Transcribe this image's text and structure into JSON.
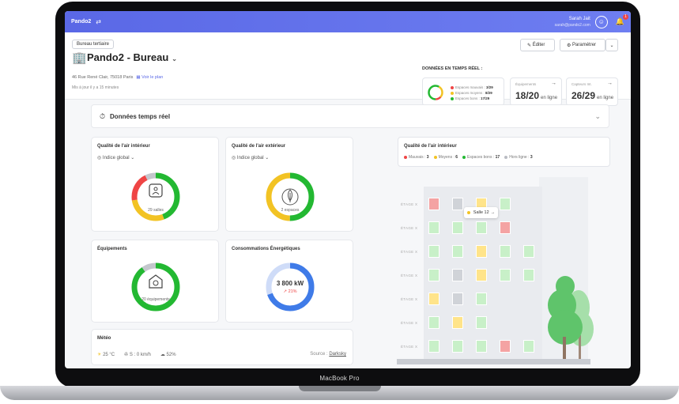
{
  "app": {
    "name": "Pando2",
    "user_name": "Sarah Jait",
    "user_email": "sarah@pando2.com",
    "notifications": "1"
  },
  "header": {
    "tag": "Bureau tertiaire",
    "title": "Pando2 - Bureau",
    "address": "46 Rue René Clair, 75018 Paris",
    "plan_link": "Voir le plan",
    "updated": "Mis à jour il y a 15 minutes",
    "edit_label": "Éditer",
    "settings_label": "Paramétrer",
    "realtime_label": "DONNÉES EN TEMPS RÉEL :"
  },
  "summary": {
    "spaces": [
      {
        "label": "Espaces mauvais :",
        "value": "3/29",
        "color": "#ef4545"
      },
      {
        "label": "Espaces moyens :",
        "value": "8/29",
        "color": "#f2c324"
      },
      {
        "label": "Espaces bons :",
        "value": "17/29",
        "color": "#23b832"
      }
    ],
    "equipment": {
      "label": "Équipements",
      "value": "18/20",
      "suffix": "en ligne"
    },
    "sensors": {
      "label": "Capteurs Int.",
      "value": "26/29",
      "suffix": "en ligne"
    }
  },
  "realtime": {
    "title": "Données temps réel"
  },
  "cards": {
    "air_in": {
      "title": "Qualité de l'air intérieur",
      "subtitle": "Indice global",
      "center": "29 salles"
    },
    "air_out": {
      "title": "Qualité de l'air extérieur",
      "subtitle": "Indice global",
      "center": "2 espaces"
    },
    "equip": {
      "title": "Équipements",
      "center": "20 équipements"
    },
    "energy": {
      "title": "Consommations Énergétiques",
      "value": "3 800 kW",
      "delta": "21%"
    },
    "meteo": {
      "title": "Météo",
      "temp": "25 °C",
      "wind": "S : 0 km/h",
      "humidity": "52%",
      "source_label": "Source :",
      "source": "Darksky"
    }
  },
  "building": {
    "title": "Qualité de l'air intérieur",
    "legend": [
      {
        "label": "Mauvais :",
        "value": "3",
        "color": "#ef4545"
      },
      {
        "label": "Moyens :",
        "value": "6",
        "color": "#f2c324"
      },
      {
        "label": "Espaces bons :",
        "value": "17",
        "color": "#23b832"
      },
      {
        "label": "Hors ligne :",
        "value": "3",
        "color": "#b9bcc3"
      }
    ],
    "floor_label": "ÉTAGE X",
    "tooltip": "Salle 12",
    "rows": [
      [
        "#f4a3a3",
        "#d0d3d8",
        "#ffe48a",
        "#c8f0c8"
      ],
      [
        "#c8f0c8",
        "#c8f0c8",
        "#c8f0c8",
        "#f4a3a3"
      ],
      [
        "#c8f0c8",
        "#c8f0c8",
        "#ffe48a",
        "#c8f0c8",
        "#c8f0c8"
      ],
      [
        "#c8f0c8",
        "#d0d3d8",
        "#ffe48a",
        "#c8f0c8",
        "#c8f0c8"
      ],
      [
        "#ffe48a",
        "#d0d3d8",
        "#c8f0c8"
      ],
      [
        "#c8f0c8",
        "#ffe48a",
        "#c8f0c8"
      ],
      [
        "#c8f0c8",
        "#c8f0c8",
        "#c8f0c8",
        "#f4a3a3",
        "#c8f0c8"
      ]
    ]
  },
  "device": {
    "label": "MacBook Pro"
  }
}
